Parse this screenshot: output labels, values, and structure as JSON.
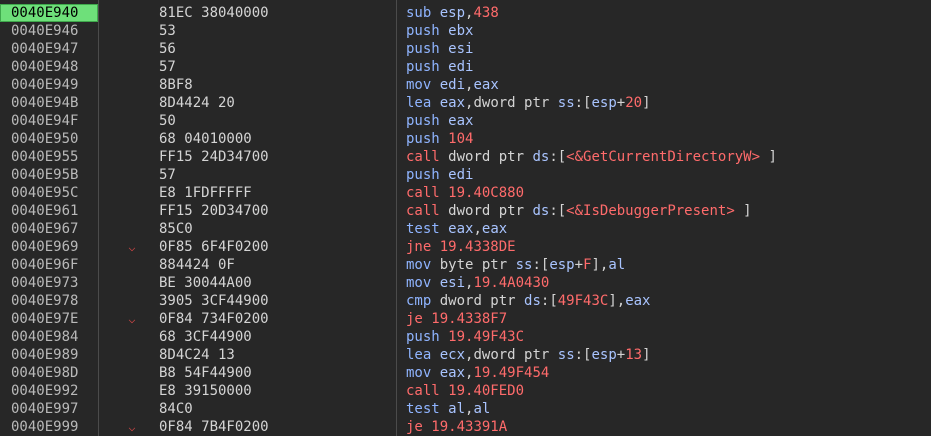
{
  "theme": {
    "background": "#272727",
    "address_color": "#b9b9b9",
    "current_row_highlight": "#6ee07a",
    "mnemonic_color": "#8fb4ff",
    "branch_color": "#ff6b6b",
    "arrow_icon": "jump-arrow-icon"
  },
  "disassembly": {
    "rows": [
      {
        "address": "0040E940",
        "bytes": "81EC 38040000",
        "current": true,
        "jump": false,
        "tokens": [
          {
            "t": "sub",
            "c": "mnem"
          },
          {
            "t": " ",
            "c": "punct"
          },
          {
            "t": "esp",
            "c": "reg"
          },
          {
            "t": ",",
            "c": "punct"
          },
          {
            "t": "438",
            "c": "num"
          }
        ]
      },
      {
        "address": "0040E946",
        "bytes": "53",
        "jump": false,
        "tokens": [
          {
            "t": "push",
            "c": "mnem"
          },
          {
            "t": " ",
            "c": "punct"
          },
          {
            "t": "ebx",
            "c": "reg"
          }
        ]
      },
      {
        "address": "0040E947",
        "bytes": "56",
        "jump": false,
        "tokens": [
          {
            "t": "push",
            "c": "mnem"
          },
          {
            "t": " ",
            "c": "punct"
          },
          {
            "t": "esi",
            "c": "reg"
          }
        ]
      },
      {
        "address": "0040E948",
        "bytes": "57",
        "jump": false,
        "tokens": [
          {
            "t": "push",
            "c": "mnem"
          },
          {
            "t": " ",
            "c": "punct"
          },
          {
            "t": "edi",
            "c": "reg"
          }
        ]
      },
      {
        "address": "0040E949",
        "bytes": "8BF8",
        "jump": false,
        "tokens": [
          {
            "t": "mov",
            "c": "mnem"
          },
          {
            "t": " ",
            "c": "punct"
          },
          {
            "t": "edi",
            "c": "reg"
          },
          {
            "t": ",",
            "c": "punct"
          },
          {
            "t": "eax",
            "c": "reg"
          }
        ]
      },
      {
        "address": "0040E94B",
        "bytes": "8D4424 20",
        "jump": false,
        "tokens": [
          {
            "t": "lea",
            "c": "mnem"
          },
          {
            "t": " ",
            "c": "punct"
          },
          {
            "t": "eax",
            "c": "reg"
          },
          {
            "t": ",",
            "c": "punct"
          },
          {
            "t": "dword ptr",
            "c": "size"
          },
          {
            "t": " ",
            "c": "punct"
          },
          {
            "t": "ss",
            "c": "seg"
          },
          {
            "t": ":[",
            "c": "punct"
          },
          {
            "t": "esp",
            "c": "reg"
          },
          {
            "t": "+",
            "c": "punct"
          },
          {
            "t": "20",
            "c": "num"
          },
          {
            "t": "]",
            "c": "punct"
          }
        ]
      },
      {
        "address": "0040E94F",
        "bytes": "50",
        "jump": false,
        "tokens": [
          {
            "t": "push",
            "c": "mnem"
          },
          {
            "t": " ",
            "c": "punct"
          },
          {
            "t": "eax",
            "c": "reg"
          }
        ]
      },
      {
        "address": "0040E950",
        "bytes": "68 04010000",
        "jump": false,
        "tokens": [
          {
            "t": "push",
            "c": "mnem"
          },
          {
            "t": " ",
            "c": "punct"
          },
          {
            "t": "104",
            "c": "num"
          }
        ]
      },
      {
        "address": "0040E955",
        "bytes": "FF15 24D34700",
        "jump": false,
        "tokens": [
          {
            "t": "call",
            "c": "call"
          },
          {
            "t": " ",
            "c": "punct"
          },
          {
            "t": "dword ptr",
            "c": "size"
          },
          {
            "t": " ",
            "c": "punct"
          },
          {
            "t": "ds",
            "c": "seg"
          },
          {
            "t": ":[",
            "c": "punct"
          },
          {
            "t": "<&GetCurrentDirectoryW>",
            "c": "api"
          },
          {
            "t": " ]",
            "c": "punct"
          }
        ]
      },
      {
        "address": "0040E95B",
        "bytes": "57",
        "jump": false,
        "tokens": [
          {
            "t": "push",
            "c": "mnem"
          },
          {
            "t": " ",
            "c": "punct"
          },
          {
            "t": "edi",
            "c": "reg"
          }
        ]
      },
      {
        "address": "0040E95C",
        "bytes": "E8 1FDFFFFF",
        "jump": false,
        "tokens": [
          {
            "t": "call",
            "c": "call"
          },
          {
            "t": " ",
            "c": "punct"
          },
          {
            "t": "19.40C880",
            "c": "addr"
          }
        ]
      },
      {
        "address": "0040E961",
        "bytes": "FF15 20D34700",
        "jump": false,
        "tokens": [
          {
            "t": "call",
            "c": "call"
          },
          {
            "t": " ",
            "c": "punct"
          },
          {
            "t": "dword ptr",
            "c": "size"
          },
          {
            "t": " ",
            "c": "punct"
          },
          {
            "t": "ds",
            "c": "seg"
          },
          {
            "t": ":[",
            "c": "punct"
          },
          {
            "t": "<&IsDebuggerPresent>",
            "c": "api"
          },
          {
            "t": " ]",
            "c": "punct"
          }
        ]
      },
      {
        "address": "0040E967",
        "bytes": "85C0",
        "jump": false,
        "tokens": [
          {
            "t": "test",
            "c": "mnem"
          },
          {
            "t": " ",
            "c": "punct"
          },
          {
            "t": "eax",
            "c": "reg"
          },
          {
            "t": ",",
            "c": "punct"
          },
          {
            "t": "eax",
            "c": "reg"
          }
        ]
      },
      {
        "address": "0040E969",
        "bytes": "0F85 6F4F0200",
        "jump": true,
        "tokens": [
          {
            "t": "jne",
            "c": "jump"
          },
          {
            "t": " ",
            "c": "punct"
          },
          {
            "t": "19.4338DE",
            "c": "addr"
          }
        ]
      },
      {
        "address": "0040E96F",
        "bytes": "884424 0F",
        "jump": false,
        "tokens": [
          {
            "t": "mov",
            "c": "mnem"
          },
          {
            "t": " ",
            "c": "punct"
          },
          {
            "t": "byte ptr",
            "c": "size"
          },
          {
            "t": " ",
            "c": "punct"
          },
          {
            "t": "ss",
            "c": "seg"
          },
          {
            "t": ":[",
            "c": "punct"
          },
          {
            "t": "esp",
            "c": "reg"
          },
          {
            "t": "+",
            "c": "punct"
          },
          {
            "t": "F",
            "c": "num"
          },
          {
            "t": "],",
            "c": "punct"
          },
          {
            "t": "al",
            "c": "reg"
          }
        ]
      },
      {
        "address": "0040E973",
        "bytes": "BE 30044A00",
        "jump": false,
        "tokens": [
          {
            "t": "mov",
            "c": "mnem"
          },
          {
            "t": " ",
            "c": "punct"
          },
          {
            "t": "esi",
            "c": "reg"
          },
          {
            "t": ",",
            "c": "punct"
          },
          {
            "t": "19.4A0430",
            "c": "addr"
          }
        ]
      },
      {
        "address": "0040E978",
        "bytes": "3905 3CF44900",
        "jump": false,
        "tokens": [
          {
            "t": "cmp",
            "c": "mnem"
          },
          {
            "t": " ",
            "c": "punct"
          },
          {
            "t": "dword ptr",
            "c": "size"
          },
          {
            "t": " ",
            "c": "punct"
          },
          {
            "t": "ds",
            "c": "seg"
          },
          {
            "t": ":[",
            "c": "punct"
          },
          {
            "t": "49F43C",
            "c": "num"
          },
          {
            "t": "],",
            "c": "punct"
          },
          {
            "t": "eax",
            "c": "reg"
          }
        ]
      },
      {
        "address": "0040E97E",
        "bytes": "0F84 734F0200",
        "jump": true,
        "tokens": [
          {
            "t": "je",
            "c": "jump"
          },
          {
            "t": " ",
            "c": "punct"
          },
          {
            "t": "19.4338F7",
            "c": "addr"
          }
        ]
      },
      {
        "address": "0040E984",
        "bytes": "68 3CF44900",
        "jump": false,
        "tokens": [
          {
            "t": "push",
            "c": "mnem"
          },
          {
            "t": " ",
            "c": "punct"
          },
          {
            "t": "19.49F43C",
            "c": "addr"
          }
        ]
      },
      {
        "address": "0040E989",
        "bytes": "8D4C24 13",
        "jump": false,
        "tokens": [
          {
            "t": "lea",
            "c": "mnem"
          },
          {
            "t": " ",
            "c": "punct"
          },
          {
            "t": "ecx",
            "c": "reg"
          },
          {
            "t": ",",
            "c": "punct"
          },
          {
            "t": "dword ptr",
            "c": "size"
          },
          {
            "t": " ",
            "c": "punct"
          },
          {
            "t": "ss",
            "c": "seg"
          },
          {
            "t": ":[",
            "c": "punct"
          },
          {
            "t": "esp",
            "c": "reg"
          },
          {
            "t": "+",
            "c": "punct"
          },
          {
            "t": "13",
            "c": "num"
          },
          {
            "t": "]",
            "c": "punct"
          }
        ]
      },
      {
        "address": "0040E98D",
        "bytes": "B8 54F44900",
        "jump": false,
        "tokens": [
          {
            "t": "mov",
            "c": "mnem"
          },
          {
            "t": " ",
            "c": "punct"
          },
          {
            "t": "eax",
            "c": "reg"
          },
          {
            "t": ",",
            "c": "punct"
          },
          {
            "t": "19.49F454",
            "c": "addr"
          }
        ]
      },
      {
        "address": "0040E992",
        "bytes": "E8 39150000",
        "jump": false,
        "tokens": [
          {
            "t": "call",
            "c": "call"
          },
          {
            "t": " ",
            "c": "punct"
          },
          {
            "t": "19.40FED0",
            "c": "addr"
          }
        ]
      },
      {
        "address": "0040E997",
        "bytes": "84C0",
        "jump": false,
        "tokens": [
          {
            "t": "test",
            "c": "mnem"
          },
          {
            "t": " ",
            "c": "punct"
          },
          {
            "t": "al",
            "c": "reg"
          },
          {
            "t": ",",
            "c": "punct"
          },
          {
            "t": "al",
            "c": "reg"
          }
        ]
      },
      {
        "address": "0040E999",
        "bytes": "0F84 7B4F0200",
        "jump": true,
        "tokens": [
          {
            "t": "je",
            "c": "jump"
          },
          {
            "t": " ",
            "c": "punct"
          },
          {
            "t": "19.43391A",
            "c": "addr"
          }
        ]
      }
    ]
  }
}
